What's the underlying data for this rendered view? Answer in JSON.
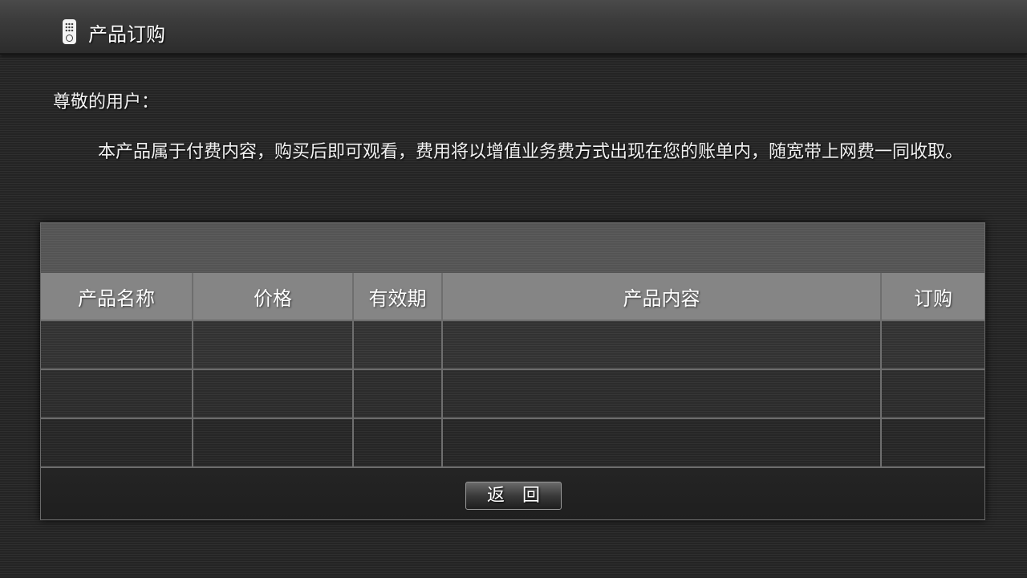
{
  "header": {
    "title": "产品订购",
    "icon": "remote-control-icon"
  },
  "notice": {
    "greeting": "尊敬的用户：",
    "message": "本产品属于付费内容，购买后即可观看，费用将以增值业务费方式出现在您的账单内，随宽带上网费一同收取。"
  },
  "table": {
    "columns": [
      "产品名称",
      "价格",
      "有效期",
      "产品内容",
      "订购"
    ],
    "rows": [
      [
        "",
        "",
        "",
        "",
        ""
      ],
      [
        "",
        "",
        "",
        "",
        ""
      ],
      [
        "",
        "",
        "",
        "",
        ""
      ]
    ]
  },
  "footer": {
    "back_label": "返　回"
  },
  "colors": {
    "header_cell_bg": "#858585",
    "grid_line": "#6e6e6e",
    "background": "#2a2a2a"
  }
}
